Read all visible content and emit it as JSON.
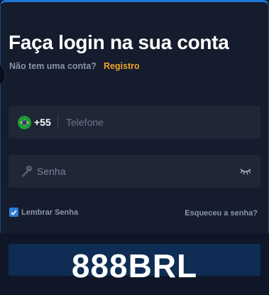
{
  "login": {
    "title": "Faça login na sua conta",
    "no_account_text": "Não tem uma conta?",
    "register_link": "Registro",
    "phone": {
      "country_flag": "brazil-flag-icon",
      "dial_code": "+55",
      "placeholder": "Telefone",
      "value": ""
    },
    "password": {
      "icon": "key-icon",
      "placeholder": "Senha",
      "value": "",
      "toggle_icon": "eye-closed-icon"
    },
    "remember_label": "Lembrar Senha",
    "remember_checked": true,
    "forgot_link": "Esqueceu a senha?",
    "promo_code": "888BRL"
  },
  "colors": {
    "background": "#141c2d",
    "field": "#1f2636",
    "accent_link": "#f2a226",
    "frame_border": "#1e79d8",
    "checkbox": "#2c7cd8",
    "submit_button": "#0e2c54"
  }
}
